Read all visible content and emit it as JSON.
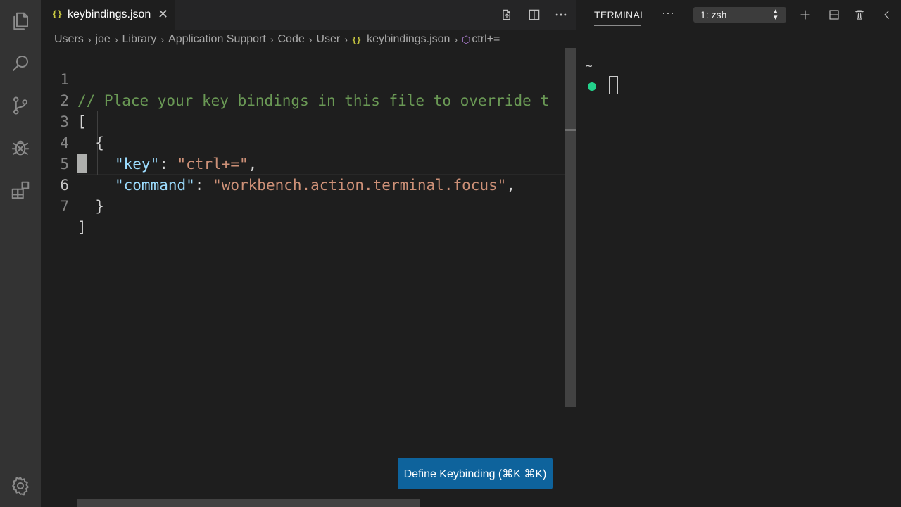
{
  "activity_bar": {
    "items": [
      "explorer-icon",
      "search-icon",
      "source-control-icon",
      "debug-icon",
      "extensions-icon"
    ],
    "bottom": "gear-icon"
  },
  "editor": {
    "tab": {
      "icon_text": "{}",
      "title": "keybindings.json",
      "close_glyph": "✕"
    },
    "breadcrumb": [
      "Users",
      "joe",
      "Library",
      "Application Support",
      "Code",
      "User"
    ],
    "breadcrumb_file_icon": "{}",
    "breadcrumb_file": "keybindings.json",
    "breadcrumb_symbol": "ctrl+=",
    "breadcrumb_sep": "›",
    "lines": [
      {
        "num": "1",
        "comment": "// Place your key bindings in this file to override t"
      },
      {
        "num": "2",
        "text": "["
      },
      {
        "num": "3",
        "text": "  {"
      },
      {
        "num": "4",
        "key": "\"key\"",
        "colon": ": ",
        "value": "\"ctrl+=\"",
        "tail": ","
      },
      {
        "num": "5",
        "key": "\"command\"",
        "colon": ": ",
        "value": "\"workbench.action.terminal.focus\"",
        "tail": ","
      },
      {
        "num": "6",
        "text": "  }"
      },
      {
        "num": "7",
        "text": "]"
      }
    ],
    "active_line": "6",
    "define_keybinding_label": "Define Keybinding (⌘K ⌘K)"
  },
  "terminal": {
    "title": "TERMINAL",
    "more_glyph": "···",
    "shell_select": "1: zsh",
    "prompt_dir": "~",
    "prompt_color": "#23d18b"
  },
  "colors": {
    "comment": "#6a9955",
    "key": "#9cdcfe",
    "string": "#ce9178",
    "button": "#0e639c",
    "json_icon": "#cbcb41"
  }
}
